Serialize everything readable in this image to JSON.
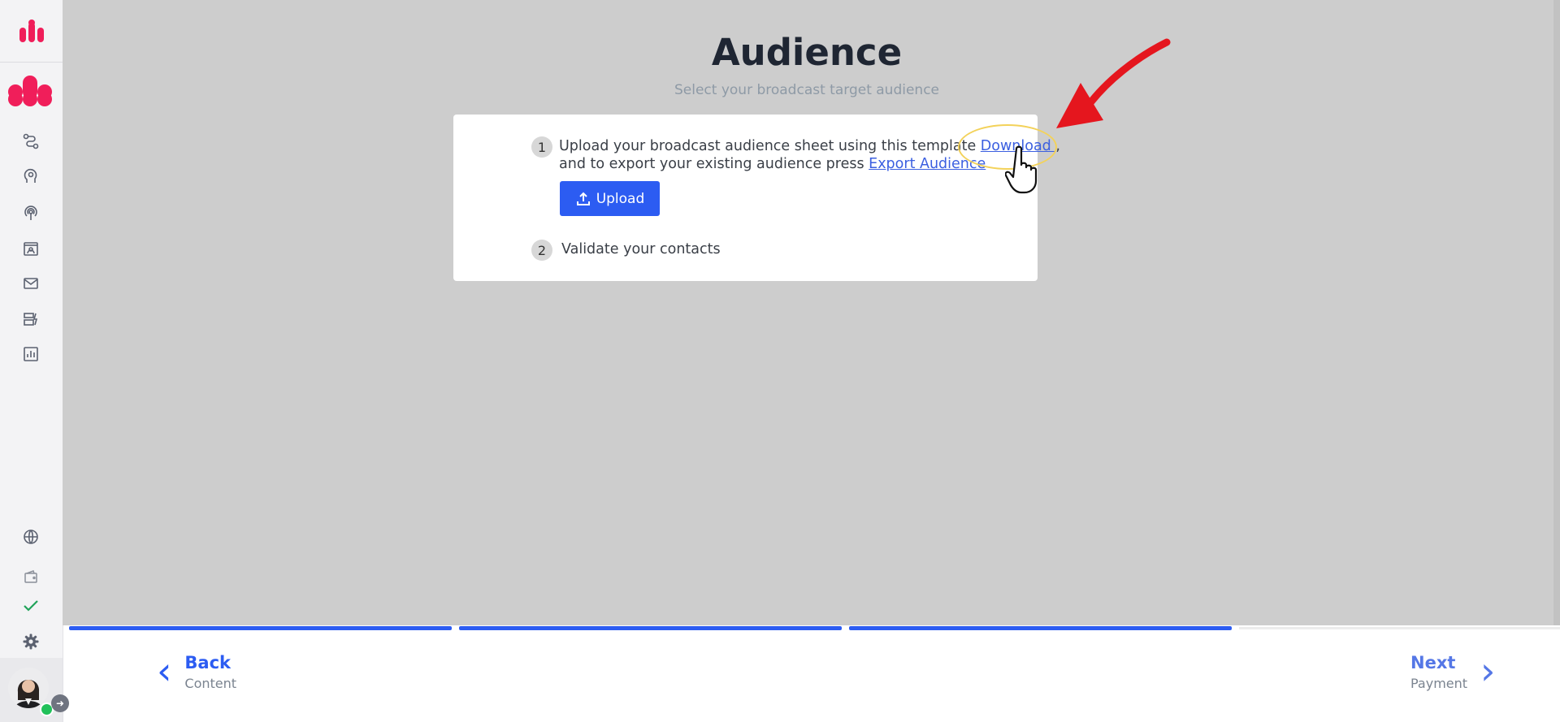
{
  "sidebar": {
    "nav_icons": [
      "flow-icon",
      "bot-brain-icon",
      "broadcast-icon",
      "contacts-icon",
      "mail-icon",
      "templates-icon",
      "analytics-icon"
    ],
    "bottom_icons": [
      "globe-icon",
      "wallet-icon",
      "check-icon",
      "gear-icon"
    ],
    "brand_color": "#f01e5a"
  },
  "header": {
    "title": "Audience",
    "subtitle": "Select your broadcast target audience"
  },
  "card": {
    "step1": {
      "number": "1",
      "text_part1": "Upload your broadcast audience sheet using this template ",
      "download_link": "Download ",
      "comma": ",",
      "text_part2": "and to export your existing audience press ",
      "export_link": "Export Audience"
    },
    "upload_button": "Upload",
    "step2": {
      "number": "2",
      "text": "Validate your contacts"
    }
  },
  "progress": {
    "completed_steps": 3,
    "total_steps": 4,
    "accent": "#2c5cf2"
  },
  "footer": {
    "back_label": "Back",
    "back_sub": "Content",
    "next_label": "Next",
    "next_sub": "Payment"
  }
}
